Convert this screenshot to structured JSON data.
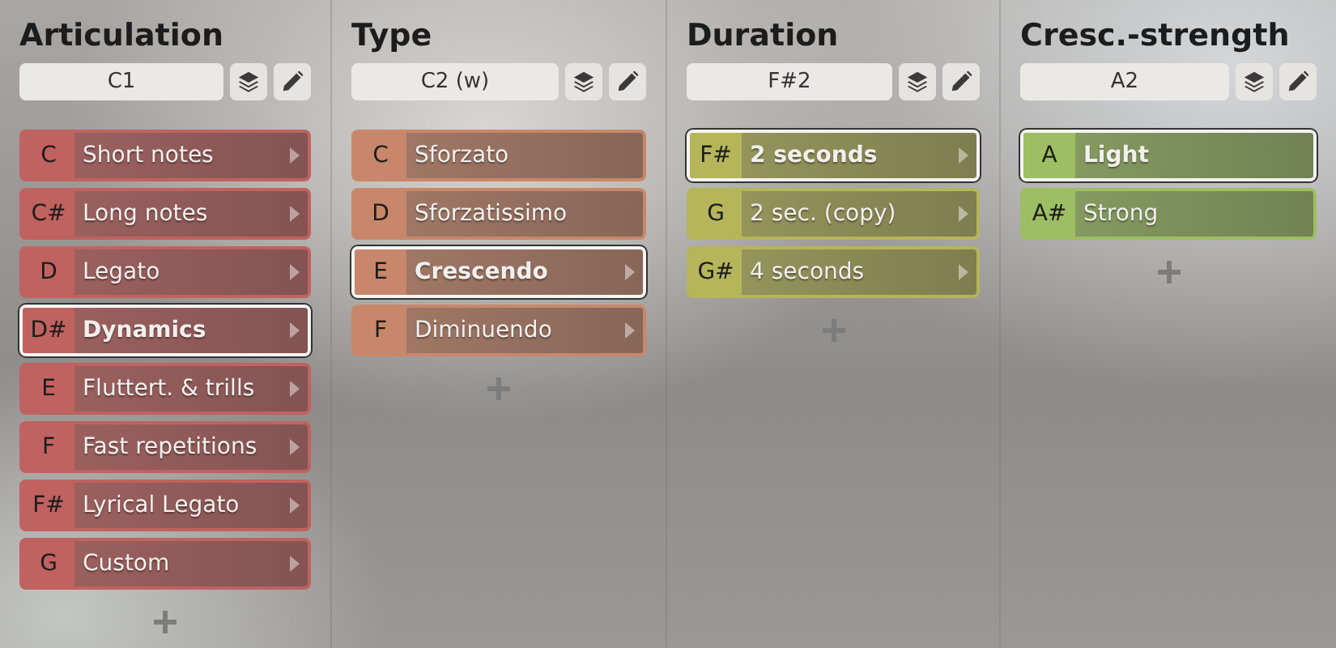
{
  "columns": [
    {
      "title": "Articulation",
      "field": "C1",
      "color": "#c0625f",
      "items": [
        {
          "key": "C",
          "label": "Short notes",
          "selected": false,
          "has_submenu": true
        },
        {
          "key": "C#",
          "label": "Long notes",
          "selected": false,
          "has_submenu": true
        },
        {
          "key": "D",
          "label": "Legato",
          "selected": false,
          "has_submenu": true
        },
        {
          "key": "D#",
          "label": "Dynamics",
          "selected": true,
          "has_submenu": true
        },
        {
          "key": "E",
          "label": "Fluttert. & trills",
          "selected": false,
          "has_submenu": true
        },
        {
          "key": "F",
          "label": "Fast repetitions",
          "selected": false,
          "has_submenu": true
        },
        {
          "key": "F#",
          "label": "Lyrical Legato",
          "selected": false,
          "has_submenu": true
        },
        {
          "key": "G",
          "label": "Custom",
          "selected": false,
          "has_submenu": true
        }
      ]
    },
    {
      "title": "Type",
      "field": "C2 (w)",
      "color": "#c8876a",
      "items": [
        {
          "key": "C",
          "label": "Sforzato",
          "selected": false,
          "has_submenu": false
        },
        {
          "key": "D",
          "label": "Sforzatissimo",
          "selected": false,
          "has_submenu": false
        },
        {
          "key": "E",
          "label": "Crescendo",
          "selected": true,
          "has_submenu": true
        },
        {
          "key": "F",
          "label": "Diminuendo",
          "selected": false,
          "has_submenu": true
        }
      ]
    },
    {
      "title": "Duration",
      "field": "F#2",
      "color": "#b5b55a",
      "items": [
        {
          "key": "F#",
          "label": "2 seconds",
          "selected": true,
          "has_submenu": true
        },
        {
          "key": "G",
          "label": "2 sec. (copy)",
          "selected": false,
          "has_submenu": true
        },
        {
          "key": "G#",
          "label": "4 seconds",
          "selected": false,
          "has_submenu": true
        }
      ]
    },
    {
      "title": "Cresc.-strength",
      "field": "A2",
      "color": "#9dbe62",
      "items": [
        {
          "key": "A",
          "label": "Light",
          "selected": true,
          "has_submenu": false
        },
        {
          "key": "A#",
          "label": "Strong",
          "selected": false,
          "has_submenu": false
        }
      ]
    }
  ]
}
